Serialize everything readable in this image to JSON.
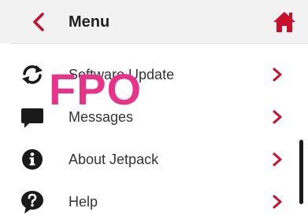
{
  "header": {
    "title": "Menu",
    "back_icon": "chevron-left-icon",
    "home_icon": "home-icon"
  },
  "menu": {
    "items": [
      {
        "label": "Software Update",
        "icon": "refresh-icon"
      },
      {
        "label": "Messages",
        "icon": "chat-bubble-icon"
      },
      {
        "label": "About Jetpack",
        "icon": "info-icon"
      },
      {
        "label": "Help",
        "icon": "question-icon"
      }
    ]
  },
  "watermark": {
    "text": "FPO"
  },
  "colors": {
    "accent": "#c8102e",
    "watermark": "#e8338a",
    "header_bg": "#f2f2f2"
  }
}
